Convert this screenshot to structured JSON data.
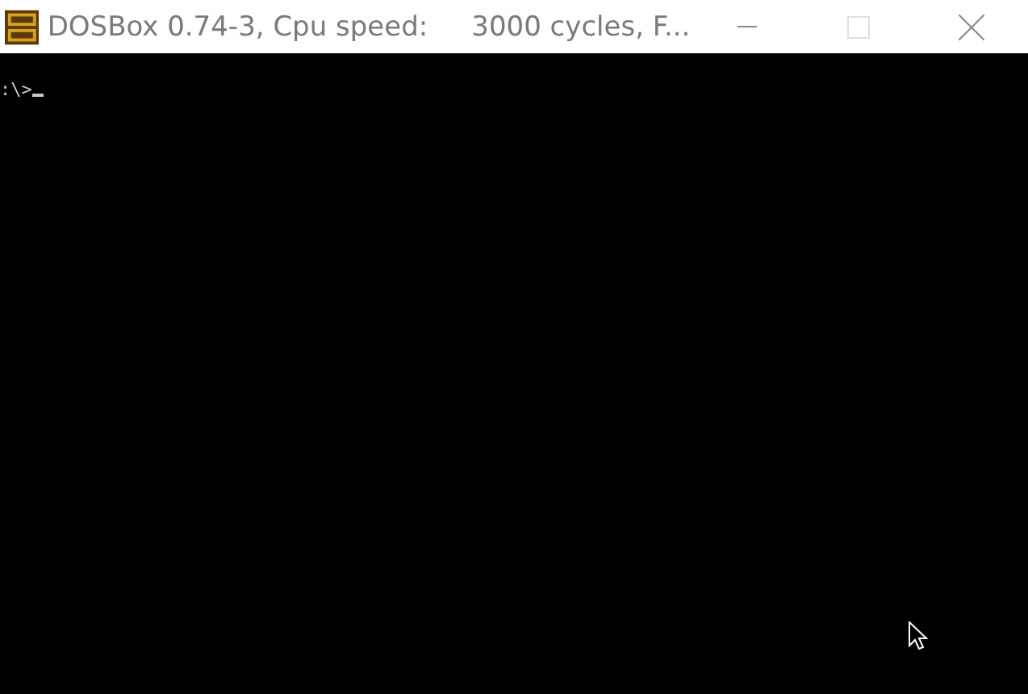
{
  "window": {
    "title": "DOSBox 0.74-3, Cpu speed:     3000 cycles, F...",
    "controls": [
      {
        "kind": "minimize",
        "disabled": false
      },
      {
        "kind": "maximize",
        "disabled": true
      },
      {
        "kind": "close",
        "disabled": false
      }
    ]
  },
  "console": {
    "prompt": ":\\>",
    "cursor": true
  }
}
